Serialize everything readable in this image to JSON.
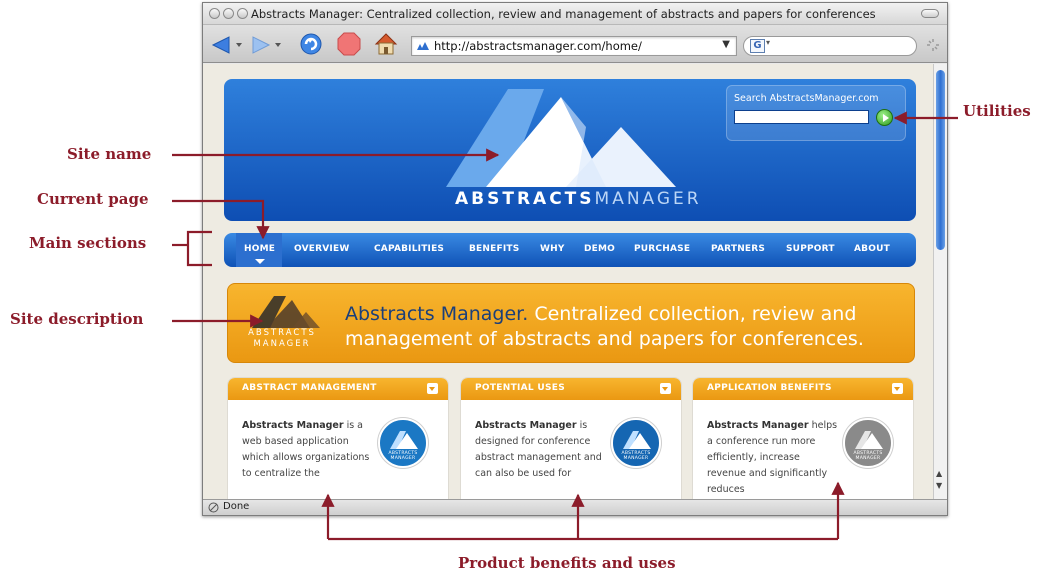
{
  "window": {
    "title": "Abstracts Manager: Centralized collection, review and management of abstracts and papers for conferences",
    "url": "http://abstractsmanager.com/home/",
    "status": "Done",
    "search_engine_glyph": "G"
  },
  "site": {
    "logo_word_bold": "ABSTRACTS",
    "logo_word_light": "MANAGER",
    "search_label": "Search AbstractsManager.com",
    "search_value": "",
    "nav": [
      "HOME",
      "OVERVIEW",
      "CAPABILITIES",
      "BENEFITS",
      "WHY",
      "DEMO",
      "PURCHASE",
      "PARTNERS",
      "SUPPORT",
      "ABOUT"
    ],
    "current_nav": "HOME",
    "description_brand": "Abstracts Manager.",
    "description_text": "Centralized collection, review and management of abstracts and papers for conferences.",
    "description_logo_line1": "ABSTRACTS",
    "description_logo_line2": "MANAGER",
    "cards": [
      {
        "title": "ABSTRACT MANAGEMENT",
        "lead": "Abstracts Manager",
        "text": "is a web based application which allows organizations to centralize the",
        "badge_color": "#1b78c4"
      },
      {
        "title": "POTENTIAL USES",
        "lead": "Abstracts Manager",
        "text": "is designed for conference abstract management and can also be used for",
        "badge_color": "#1566b2"
      },
      {
        "title": "APPLICATION BENEFITS",
        "lead": "Abstracts Manager",
        "text": "helps a conference run more efficiently, increase revenue and significantly reduces",
        "badge_color": "#8a8a8a"
      }
    ],
    "badge_line1": "ABSTRACTS",
    "badge_line2": "MANAGER"
  },
  "annotations": {
    "site_name": "Site name",
    "current_page": "Current page",
    "main_sections": "Main sections",
    "site_description": "Site description",
    "utilities": "Utilities",
    "product_benefits": "Product benefits and uses"
  },
  "colors": {
    "annotation": "#8c1c2a",
    "site_blue": "#1a5fc3",
    "site_orange": "#f4a51f"
  }
}
